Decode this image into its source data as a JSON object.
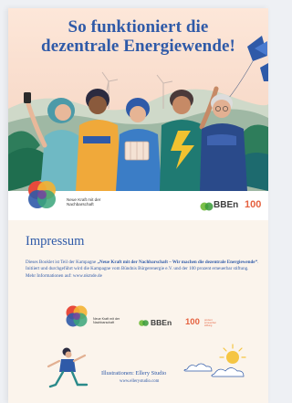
{
  "cover": {
    "title_line1": "So funktioniert die",
    "title_line2": "dezentrale Energiewende!",
    "partner_logo_text": "Neue Kraft mit der Nachbarschaft",
    "bben_logo_text": "BBEn",
    "hundred_logo_text": "100"
  },
  "impressum": {
    "heading": "Impressum",
    "text_intro": "Dieses Booklet ist Teil der Kampagne ",
    "text_campaign": "„Neue Kraft mit der Nachbarschaft – Wir machen die dezentrale Energiewende“",
    "text_rest": ". Initiiert und durchgeführt wird die Kampagne vom Bündnis Bürgerenergie e.V. und der 100 prozent erneuerbar stiftung.",
    "text_more": "Mehr Informationen auf: www.nkmde.de",
    "logo_partner_text": "Neue Kraft mit der Nachbarschaft",
    "logo_bben_text": "BBEn",
    "logo_100_text": "100",
    "logo_100_sub": "prozent erneuerbar stiftung"
  },
  "illustration": {
    "credit": "Illustrationen: Ellery Studio",
    "url": "www.ellerystudio.com"
  },
  "colors": {
    "accent_blue": "#2f5aa8",
    "orange": "#e5613f",
    "paper": "#fbf4ec"
  }
}
